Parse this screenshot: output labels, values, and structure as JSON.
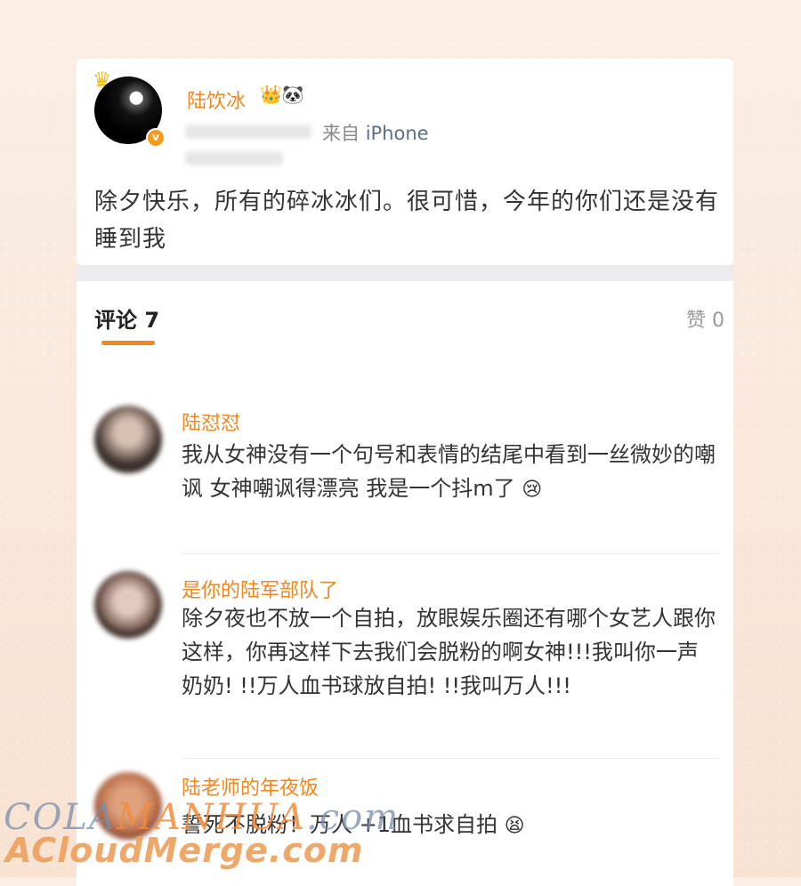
{
  "post": {
    "username": "陆饮冰",
    "badges": "👑🐼",
    "crown_icon": "crown-icon",
    "verified_icon": "V",
    "source_prefix": "来自",
    "source_device": "iPhone",
    "text": "除夕快乐，所有的碎冰冰们。很可惜，今年的你们还是没有睡到我"
  },
  "tabs": {
    "comments_label": "评论 7",
    "likes_label": "赞 0"
  },
  "comments": [
    {
      "name": "陆怼怼",
      "text": "我从女神没有一个句号和表情的结尾中看到一丝微妙的嘲讽 女神嘲讽得漂亮 我是一个抖m了",
      "emoji": "😢"
    },
    {
      "name": "是你的陆军部队了",
      "text": "除夕夜也不放一个自拍，放眼娱乐圈还有哪个女艺人跟你这样，你再这样下去我们会脱粉的啊女神!!!我叫你一声奶奶! !!万人血书球放自拍! !!我叫万人!!!"
    },
    {
      "name": "陆老师的年夜饭",
      "text": "誓死不脱粉！万人 +1血书求自拍",
      "emoji": "😫"
    }
  ],
  "watermark": {
    "line1_a": "COLA",
    "line1_b": "MANHUA",
    "line1_c": ".com",
    "line2": "ACloudMerge.com"
  },
  "colors": {
    "accent": "#f2861e",
    "device_link": "#5e6f8c"
  }
}
